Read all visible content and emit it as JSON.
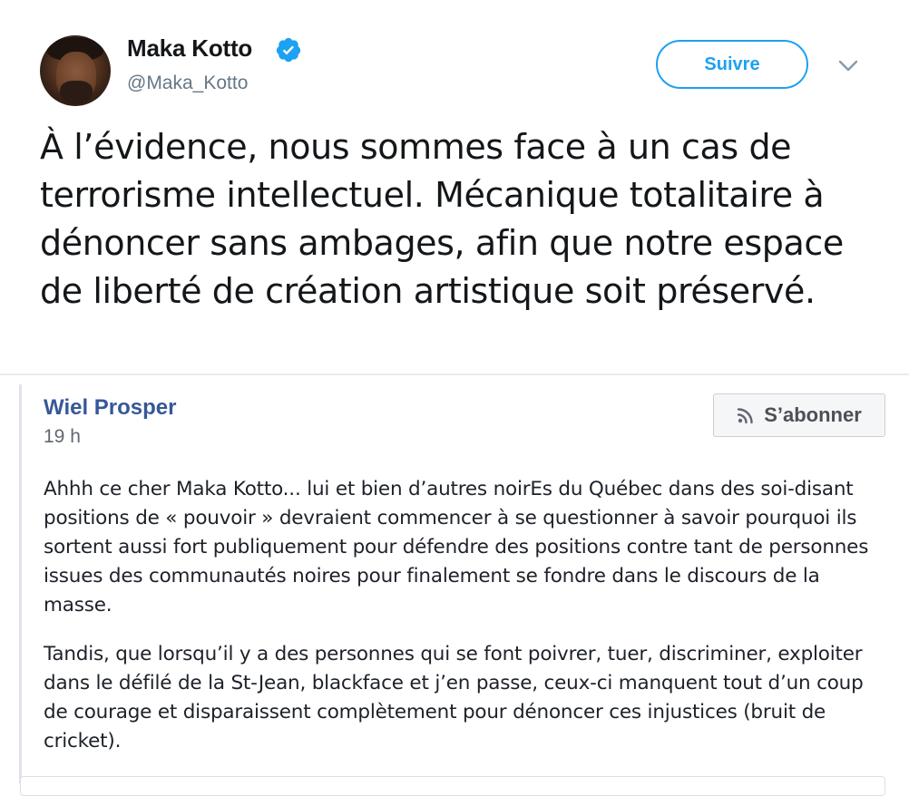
{
  "tweet": {
    "display_name": "Maka Kotto",
    "handle": "@Maka_Kotto",
    "follow_label": "Suivre",
    "text": "À l’évidence, nous sommes face à un cas de terrorisme intellectuel. Mécanique totalitaire à dénoncer sans ambages, afin que notre espace de liberté de création artistique soit préservé.",
    "icons": {
      "verified": "verified-badge-icon",
      "more": "chevron-down-icon"
    },
    "colors": {
      "accent": "#1da1f2",
      "text": "#14171a",
      "secondary": "#657786"
    }
  },
  "fb_post": {
    "author": "Wiel Prosper",
    "time": "19 h",
    "follow_label": "S’abonner",
    "paragraphs": [
      "Ahhh ce cher Maka Kotto... lui et bien d’autres noirEs du Québec dans des soi-disant positions de « pouvoir » devraient commencer à se questionner à savoir pourquoi ils sortent aussi fort publiquement pour défendre des positions contre tant de personnes issues des communautés noires pour finalement se fondre dans le discours de la masse.",
      "Tandis, que lorsqu’il y a des personnes qui se font poivrer, tuer, discriminer, exploiter dans le défilé de la St-Jean, blackface et j’en passe, ceux-ci manquent tout d’un coup de courage et disparaissent complètement pour dénoncer ces injustices (bruit de cricket)."
    ],
    "icons": {
      "follow": "rss-icon"
    },
    "colors": {
      "author": "#365899",
      "text": "#1d2129"
    }
  }
}
